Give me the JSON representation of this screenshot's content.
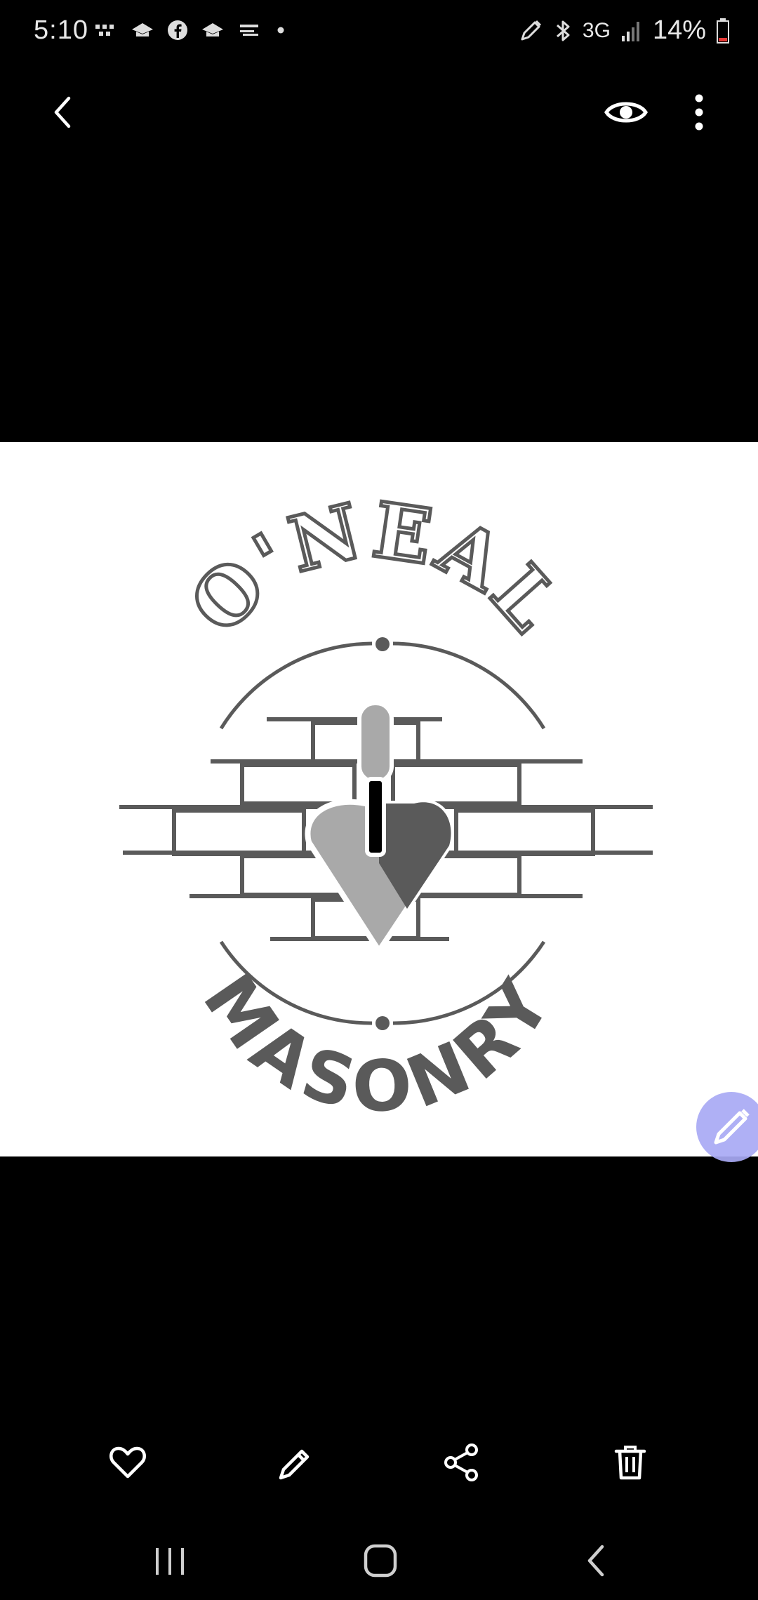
{
  "status_bar": {
    "time": "5:10",
    "network": "3G",
    "battery": "14%",
    "left_icons": [
      "grid-dots-icon",
      "hat-icon",
      "facebook-icon",
      "hat-icon",
      "screenshot-icon",
      "dot-icon"
    ],
    "right_icons": [
      "pen-icon",
      "bluetooth-icon",
      "signal-icon",
      "battery-icon"
    ]
  },
  "top_bar": {
    "back_icon": "chevron-left-icon",
    "view_icon": "eye-icon",
    "more_icon": "more-vertical-icon"
  },
  "photo": {
    "logo_top_text": "O'NEAL",
    "logo_bottom_text": "MASONRY",
    "logo_color": "#5a5a5a",
    "logo_light_color": "#a9a9a9"
  },
  "fab": {
    "icon": "pencil-icon",
    "color": "#a9aaf5"
  },
  "bottom_actions": {
    "favorite_icon": "heart-icon",
    "edit_icon": "pencil-icon",
    "share_icon": "share-icon",
    "delete_icon": "trash-icon"
  },
  "nav_bar": {
    "recent_icon": "recent-apps-icon",
    "home_icon": "home-icon",
    "back_icon": "back-icon"
  },
  "colors": {
    "background": "#000000",
    "icon": "#ffffff"
  }
}
